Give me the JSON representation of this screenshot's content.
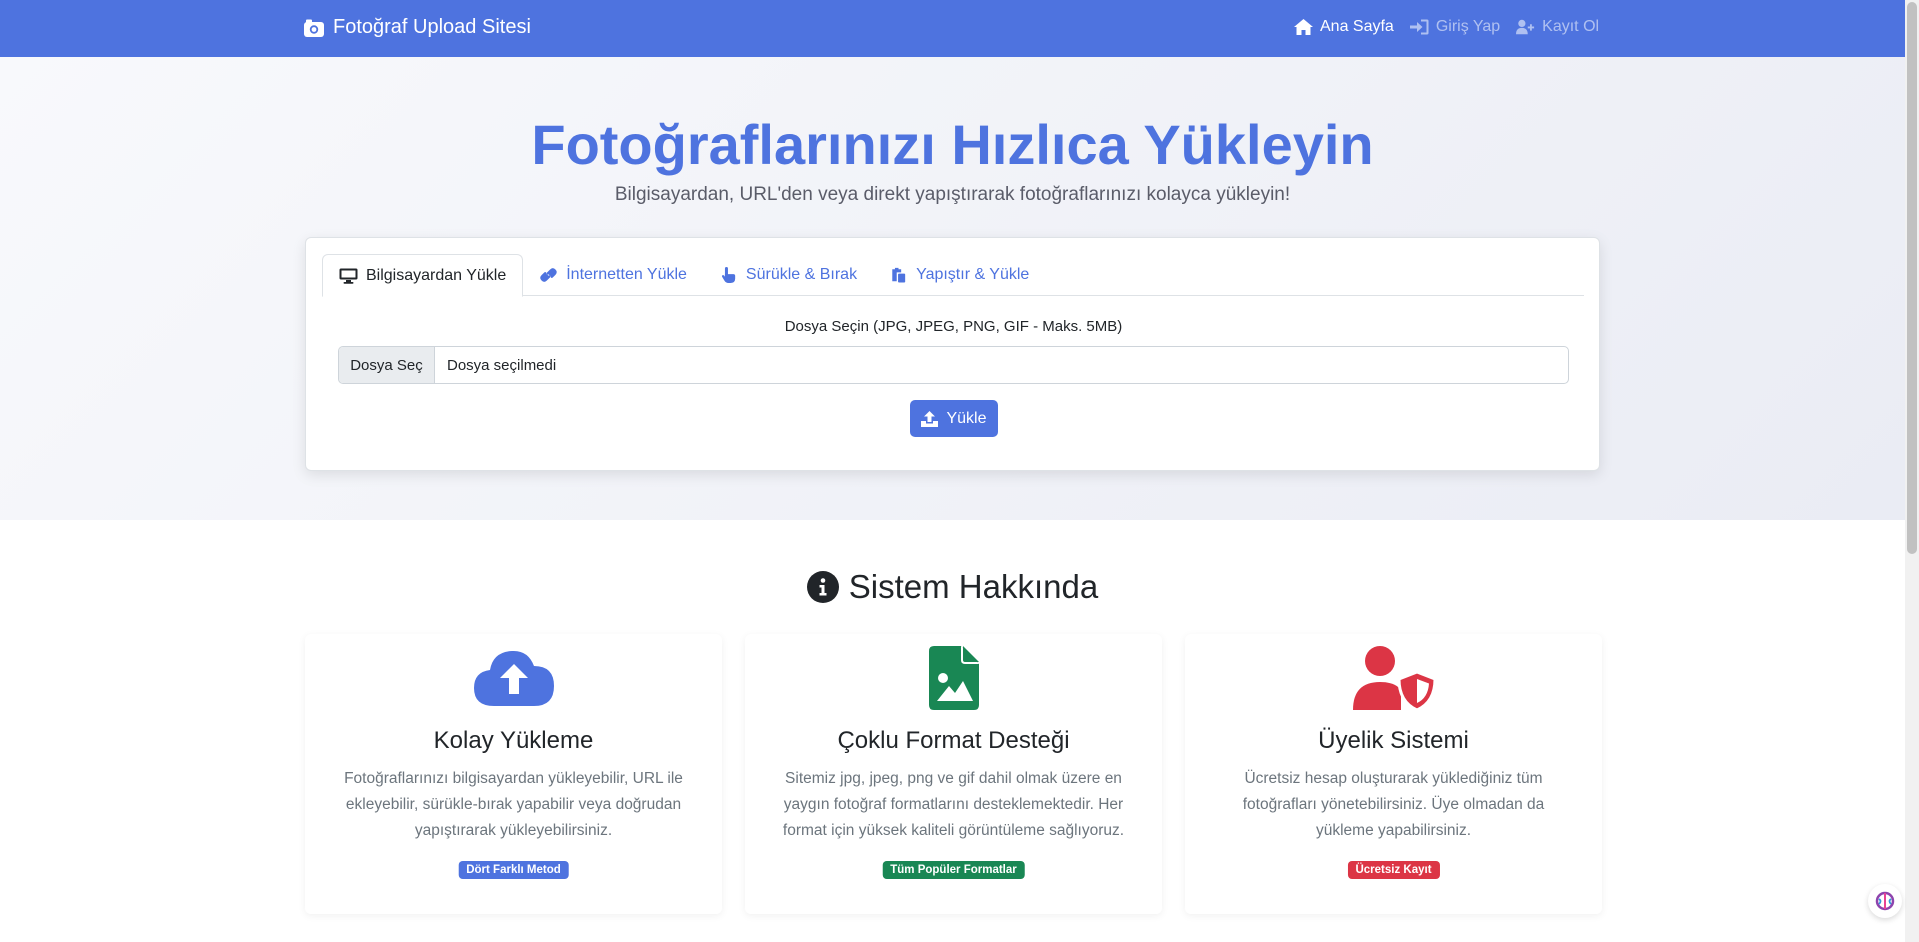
{
  "navbar": {
    "brand": "Fotoğraf Upload Sitesi",
    "links": [
      {
        "label": "Ana Sayfa",
        "icon": "home-icon",
        "active": true
      },
      {
        "label": "Giriş Yap",
        "icon": "sign-in-icon",
        "active": false
      },
      {
        "label": "Kayıt Ol",
        "icon": "user-plus-icon",
        "active": false
      }
    ]
  },
  "hero": {
    "title": "Fotoğraflarınızı Hızlıca Yükleyin",
    "subtitle": "Bilgisayardan, URL'den veya direkt yapıştırarak fotoğraflarınızı kolayca yükleyin!"
  },
  "upload": {
    "tabs": [
      {
        "label": "Bilgisayardan Yükle",
        "icon": "desktop-icon",
        "active": true
      },
      {
        "label": "İnternetten Yükle",
        "icon": "link-icon",
        "active": false
      },
      {
        "label": "Sürükle & Bırak",
        "icon": "hand-pointer-icon",
        "active": false
      },
      {
        "label": "Yapıştır & Yükle",
        "icon": "paste-icon",
        "active": false
      }
    ],
    "file_label": "Dosya Seçin (JPG, JPEG, PNG, GIF - Maks. 5MB)",
    "file_button": "Dosya Seç",
    "file_status": "Dosya seçilmedi",
    "submit_label": "Yükle"
  },
  "about": {
    "title": "Sistem Hakkında",
    "features": [
      {
        "icon": "cloud-upload-icon",
        "title": "Kolay Yükleme",
        "text": "Fotoğraflarınızı bilgisayardan yükleyebilir, URL ile ekleyebilir, sürükle-bırak yapabilir veya doğrudan yapıştırarak yükleyebilirsiniz.",
        "badge": "Dört Farklı Metod",
        "color": "#4e73df"
      },
      {
        "icon": "file-image-icon",
        "title": "Çoklu Format Desteği",
        "text": "Sitemiz jpg, jpeg, png ve gif dahil olmak üzere en yaygın fotoğraf formatlarını desteklemektedir. Her format için yüksek kaliteli görüntüleme sağlıyoruz.",
        "badge": "Tüm Popüler Formatlar",
        "color": "#198754"
      },
      {
        "icon": "user-shield-icon",
        "title": "Üyelik Sistemi",
        "text": "Ücretsiz hesap oluşturarak yüklediğiniz tüm fotoğrafları yönetebilirsiniz. Üye olmadan da yükleme yapabilirsiniz.",
        "badge": "Ücretsiz Kayıt",
        "color": "#dc3545"
      }
    ]
  },
  "colors": {
    "primary": "#4e73df",
    "success": "#198754",
    "danger": "#dc3545"
  }
}
